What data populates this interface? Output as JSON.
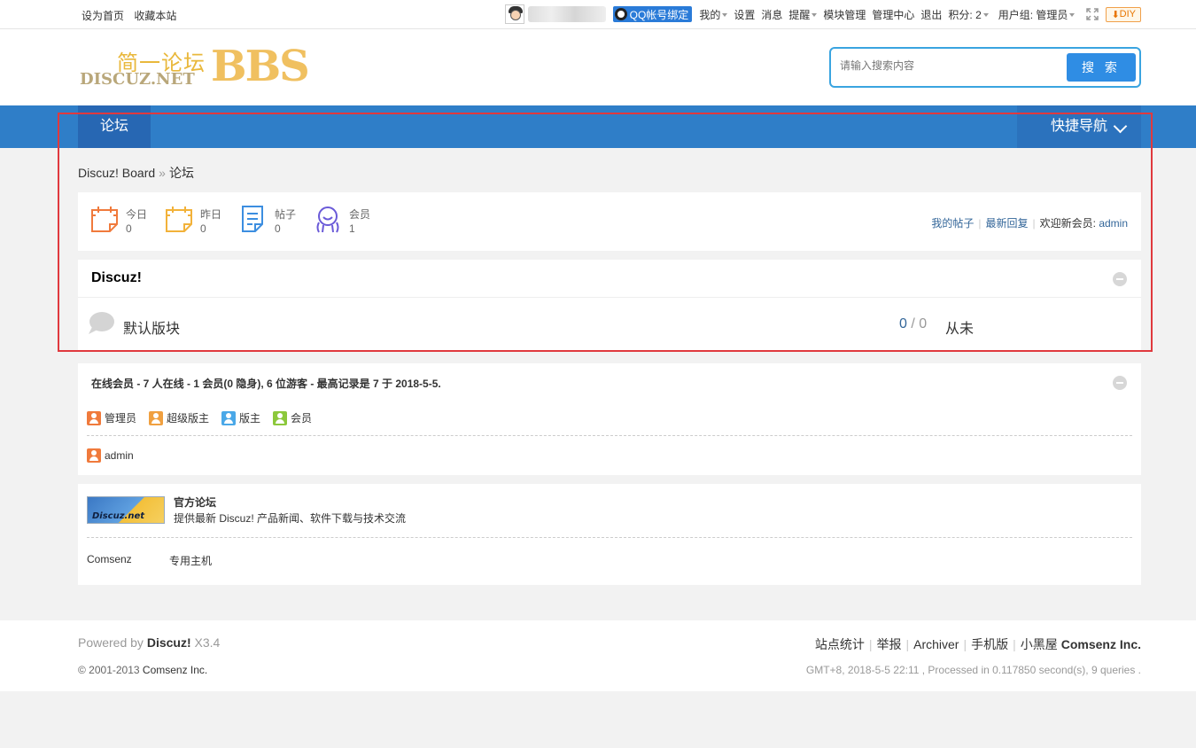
{
  "topbar": {
    "set_home": "设为首页",
    "bookmark": "收藏本站",
    "qq_bind": "QQ帐号绑定",
    "my": "我的",
    "settings": "设置",
    "messages": "消息",
    "notify": "提醒",
    "module_manage": "模块管理",
    "admin_center": "管理中心",
    "logout": "退出",
    "credits": "积分: 2",
    "usergroup": "用户组: 管理员",
    "diy": "DIY"
  },
  "header": {
    "logo_cn": "简一论坛",
    "logo_en": "DISCUZ.NET",
    "logo_bbs": "BBS",
    "search_placeholder": "请输入搜索内容",
    "search_button": "搜 索"
  },
  "nav": {
    "forum": "论坛",
    "quick_nav": "快捷导航"
  },
  "breadcrumb": {
    "home": "Discuz! Board",
    "sep": "»",
    "current": "论坛"
  },
  "stats": {
    "items": [
      {
        "label": "今日",
        "value": "0"
      },
      {
        "label": "昨日",
        "value": "0"
      },
      {
        "label": "帖子",
        "value": "0"
      },
      {
        "label": "会员",
        "value": "1"
      }
    ],
    "my_posts": "我的帖子",
    "latest_replies": "最新回复",
    "welcome": "欢迎新会员:",
    "new_member": "admin"
  },
  "category": {
    "title": "Discuz!",
    "forum_name": "默认版块",
    "threads": "0",
    "posts": "0",
    "count_sep": "/",
    "last_post": "从未"
  },
  "online": {
    "title": "在线会员 - 7 人在线 - 1 会员(0 隐身), 6 位游客 - 最高记录是 7 于 2018-5-5.",
    "legend": [
      {
        "label": "管理员",
        "color": "#f07a3c"
      },
      {
        "label": "超级版主",
        "color": "#f0a040"
      },
      {
        "label": "版主",
        "color": "#4aa8e8"
      },
      {
        "label": "会员",
        "color": "#8cc83c"
      }
    ],
    "users": [
      "admin"
    ]
  },
  "links": {
    "image_text": "Discuz.net",
    "title": "官方论坛",
    "desc": "提供最新 Discuz! 产品新闻、软件下载与技术交流",
    "text_links": [
      "Comsenz",
      "专用主机"
    ]
  },
  "footer": {
    "powered_by": "Powered by",
    "product": "Discuz!",
    "version": "X3.4",
    "copyright": "© 2001-2013",
    "company": "Comsenz Inc.",
    "links": [
      "站点统计",
      "举报",
      "Archiver",
      "手机版",
      "小黑屋"
    ],
    "brand": "Comsenz Inc.",
    "info": "GMT+8, 2018-5-5 22:11 , Processed in 0.117850 second(s), 9 queries ."
  },
  "colors": {
    "nav_bg": "#2f7ec8",
    "nav_active": "#2767b3",
    "link": "#336699",
    "highlight_border": "#e0393e"
  }
}
